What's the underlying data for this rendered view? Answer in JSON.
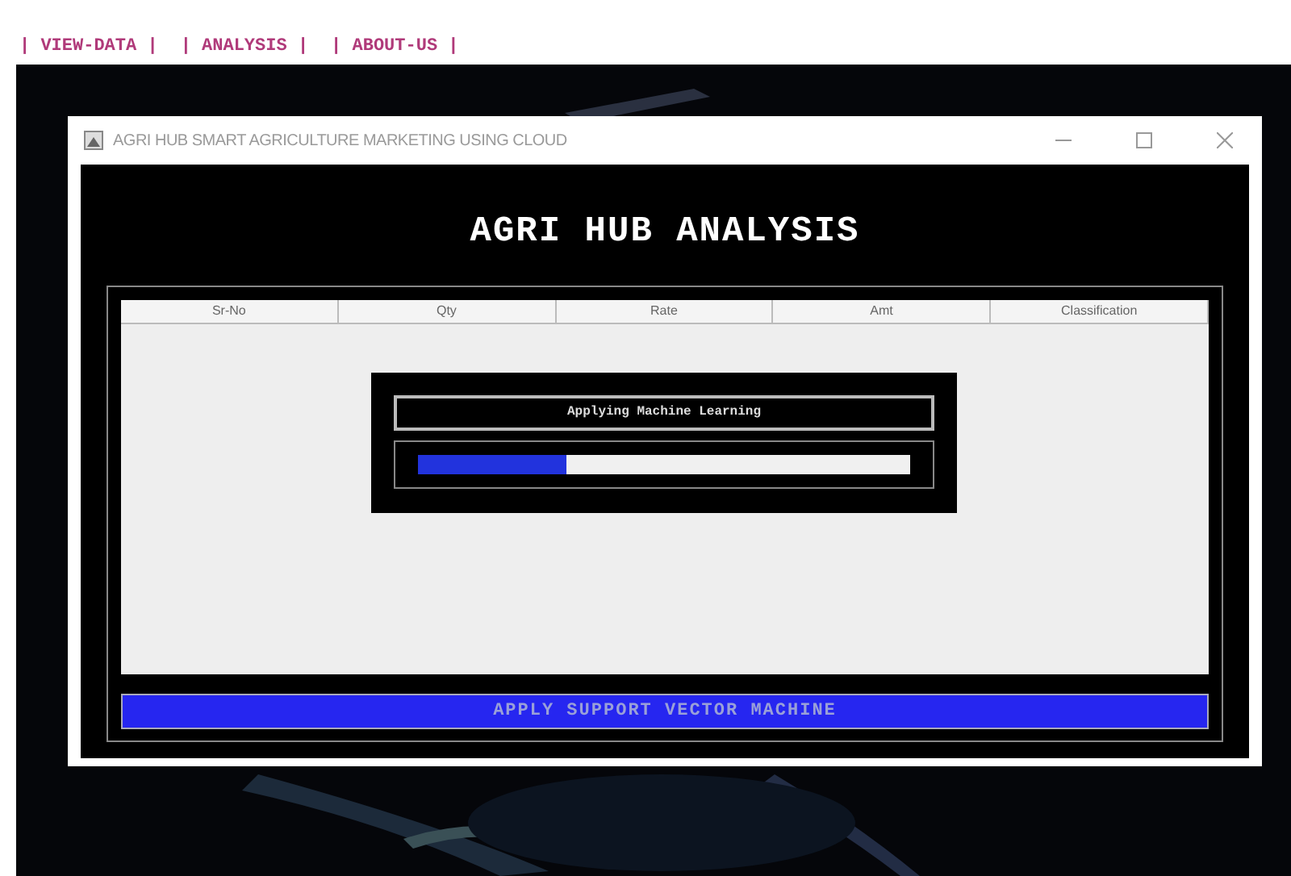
{
  "nav": [
    {
      "label": "| VIEW-DATA |"
    },
    {
      "label": "| ANALYSIS |"
    },
    {
      "label": "| ABOUT-US |"
    }
  ],
  "window": {
    "title": "AGRI HUB SMART AGRICULTURE MARKETING USING CLOUD"
  },
  "heading": "AGRI HUB ANALYSIS",
  "table": {
    "columns": [
      "Sr-No",
      "Qty",
      "Rate",
      "Amt",
      "Classification"
    ]
  },
  "progress_dialog": {
    "message": "Applying Machine Learning",
    "level": 0.3
  },
  "action_button": "APPLY SUPPORT VECTOR MACHINE"
}
